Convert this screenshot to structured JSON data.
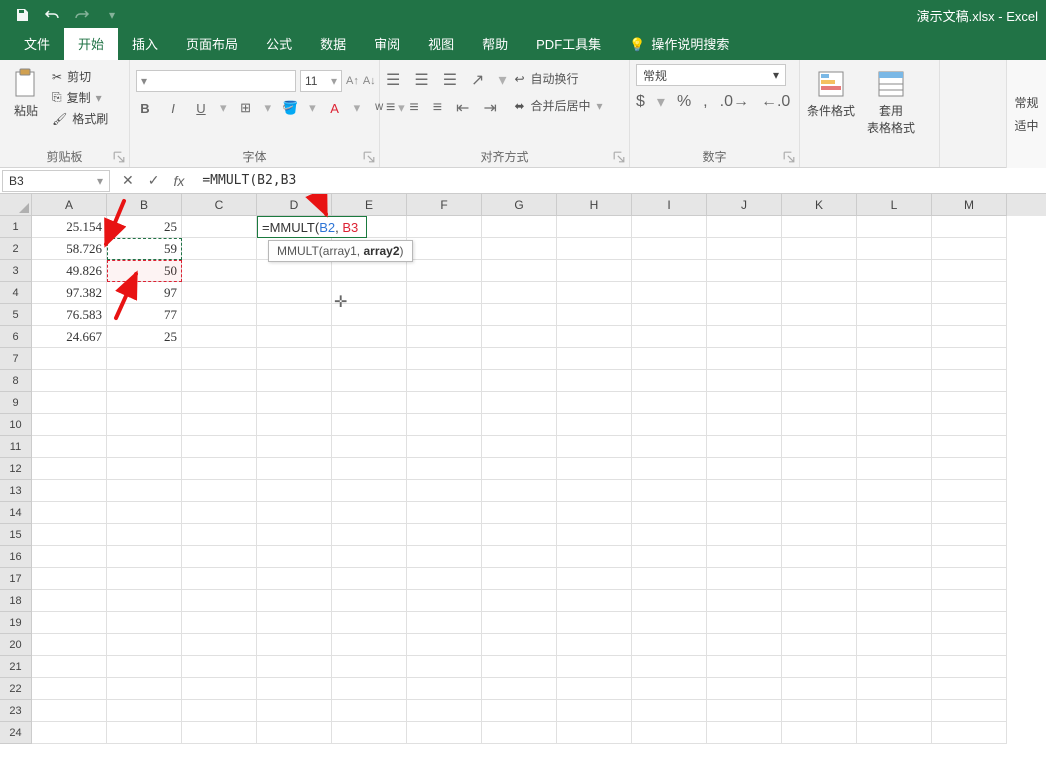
{
  "title": "演示文稿.xlsx  -  Excel",
  "tabs": [
    "文件",
    "开始",
    "插入",
    "页面布局",
    "公式",
    "数据",
    "审阅",
    "视图",
    "帮助",
    "PDF工具集"
  ],
  "tell_me": "操作说明搜索",
  "ribbon": {
    "clipboard": {
      "label": "剪贴板",
      "paste": "粘贴",
      "cut": "剪切",
      "copy": "复制",
      "format": "格式刷"
    },
    "font": {
      "label": "字体",
      "size": "11"
    },
    "align": {
      "label": "对齐方式",
      "wrap": "自动换行",
      "merge": "合并后居中"
    },
    "number": {
      "label": "数字",
      "format": "常规"
    },
    "styles": {
      "label": "",
      "cond": "条件格式",
      "table": "套用\n表格格式"
    },
    "right": {
      "a": "常规",
      "b": "适中"
    }
  },
  "namebox": "B3",
  "formula": "=MMULT(B2,B3",
  "tooltip": {
    "fn": "MMULT",
    "a1": "array1",
    "a2": "array2"
  },
  "columns": [
    "A",
    "B",
    "C",
    "D",
    "E",
    "F",
    "G",
    "H",
    "I",
    "J",
    "K",
    "L",
    "M"
  ],
  "data": {
    "A": [
      "25.154",
      "58.726",
      "49.826",
      "97.382",
      "76.583",
      "24.667"
    ],
    "B": [
      "25",
      "59",
      "50",
      "97",
      "77",
      "25"
    ]
  },
  "edit_cell": {
    "prefix": "=MMULT",
    "ref1": "B2",
    "ref2": "B3"
  },
  "rowcount": 24
}
